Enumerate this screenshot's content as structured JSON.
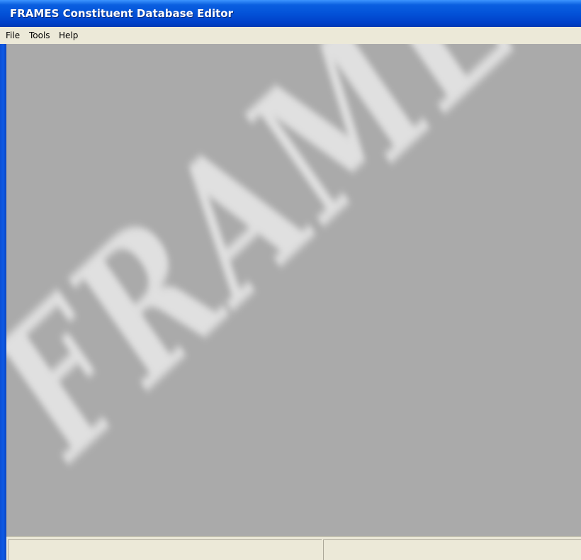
{
  "window": {
    "title": "FRAMES Constituent Database Editor"
  },
  "menu": {
    "items": [
      "File",
      "Tools",
      "Help"
    ]
  },
  "splash": {
    "logo_text": "FRAMES"
  },
  "statusbar": {
    "panels": [
      "",
      ""
    ]
  },
  "colors": {
    "titlebar": "#0352d8",
    "client_background": "#aaaaaa",
    "chrome": "#ece9d8",
    "logo": "#e6e6e6"
  }
}
